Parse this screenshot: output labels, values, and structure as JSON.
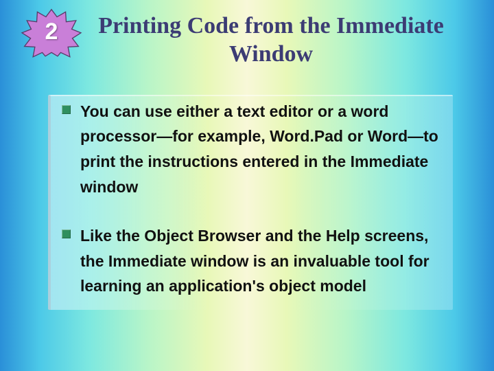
{
  "badge": {
    "number": "2"
  },
  "title": "Printing Code from the Immediate Window",
  "bullets": [
    {
      "text": "You can use either a text editor or a word processor—for example, Word.Pad or Word—to print the instructions entered in the Immediate window"
    },
    {
      "text": "Like the Object Browser and the Help screens, the Immediate window is an invaluable tool for learning an application's object model"
    }
  ]
}
